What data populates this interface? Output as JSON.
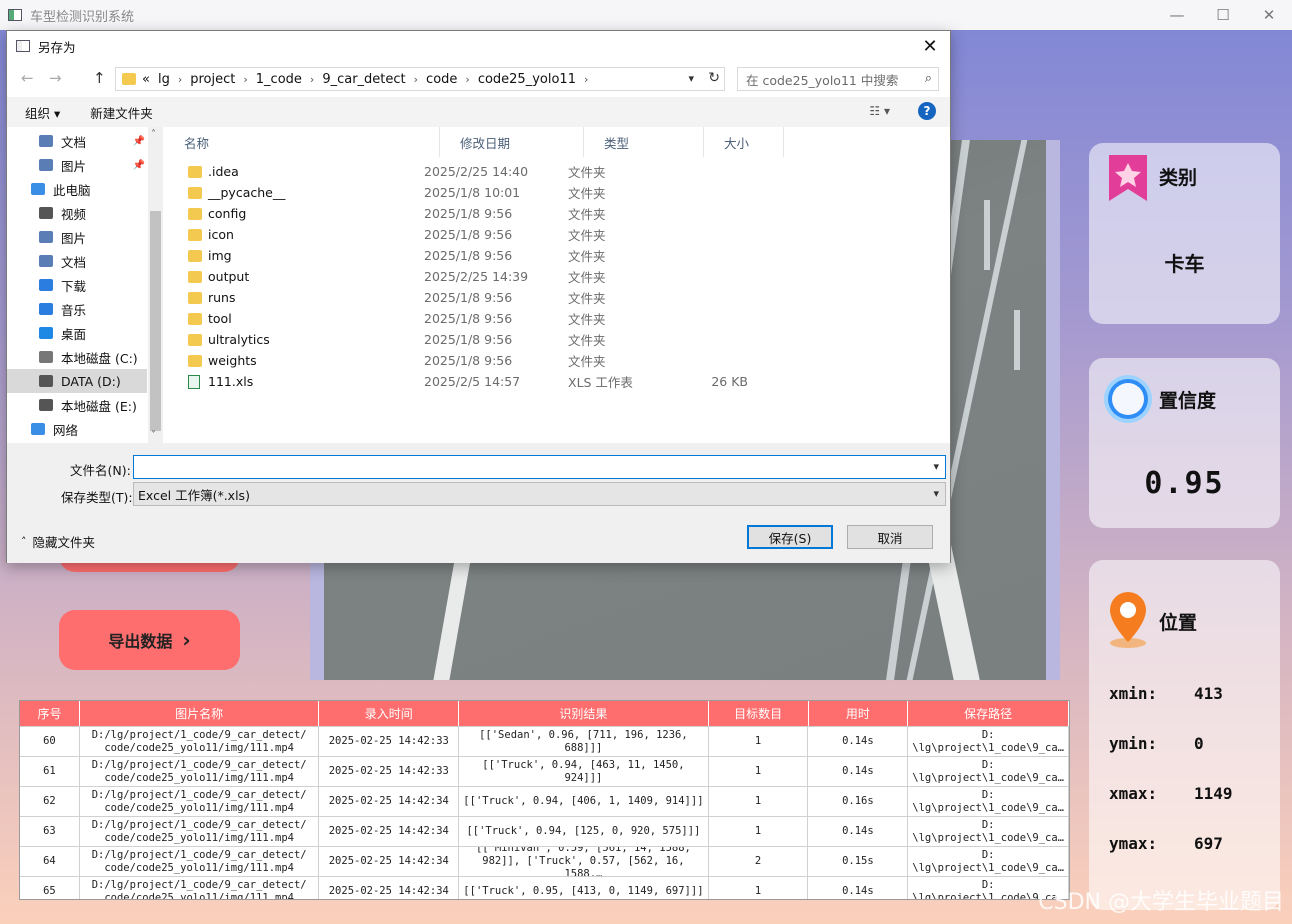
{
  "app": {
    "title": "车型检测识别系统",
    "window_controls": {
      "minimize": "—",
      "maximize": "☐",
      "close": "✕"
    }
  },
  "sidebar": {
    "export_button_label": "导出数据",
    "export_arrow": "›"
  },
  "cards": {
    "category": {
      "title": "类别",
      "value": "卡车"
    },
    "confidence": {
      "title": "置信度",
      "value": "0.95"
    },
    "location": {
      "title": "位置",
      "rows": [
        {
          "label": "xmin:",
          "value": "413"
        },
        {
          "label": "ymin:",
          "value": "0"
        },
        {
          "label": "xmax:",
          "value": "1149"
        },
        {
          "label": "ymax:",
          "value": "697"
        }
      ]
    }
  },
  "table": {
    "headers": [
      "序号",
      "图片名称",
      "录入时间",
      "识别结果",
      "目标数目",
      "用时",
      "保存路径"
    ],
    "rows": [
      [
        "60",
        "D:/lg/project/1_code/9_car_detect/\ncode/code25_yolo11/img/111.mp4",
        "2025-02-25 14:42:33",
        "[['Sedan', 0.96, [711, 196, 1236, 688]]]",
        "1",
        "0.14s",
        "D:\n\\lg\\project\\1_code\\9_ca…"
      ],
      [
        "61",
        "D:/lg/project/1_code/9_car_detect/\ncode/code25_yolo11/img/111.mp4",
        "2025-02-25 14:42:33",
        "[['Truck', 0.94, [463, 11, 1450, 924]]]",
        "1",
        "0.14s",
        "D:\n\\lg\\project\\1_code\\9_ca…"
      ],
      [
        "62",
        "D:/lg/project/1_code/9_car_detect/\ncode/code25_yolo11/img/111.mp4",
        "2025-02-25 14:42:34",
        "[['Truck', 0.94, [406, 1, 1409, 914]]]",
        "1",
        "0.16s",
        "D:\n\\lg\\project\\1_code\\9_ca…"
      ],
      [
        "63",
        "D:/lg/project/1_code/9_car_detect/\ncode/code25_yolo11/img/111.mp4",
        "2025-02-25 14:42:34",
        "[['Truck', 0.94, [125, 0, 920, 575]]]",
        "1",
        "0.14s",
        "D:\n\\lg\\project\\1_code\\9_ca…"
      ],
      [
        "64",
        "D:/lg/project/1_code/9_car_detect/\ncode/code25_yolo11/img/111.mp4",
        "2025-02-25 14:42:34",
        "[['Minivan', 0.59, [561, 14, 1588,\n982]], ['Truck', 0.57, [562, 16, 1588,…",
        "2",
        "0.15s",
        "D:\n\\lg\\project\\1_code\\9_ca…"
      ],
      [
        "65",
        "D:/lg/project/1_code/9_car_detect/\ncode/code25_yolo11/img/111.mp4",
        "2025-02-25 14:42:34",
        "[['Truck', 0.95, [413, 0, 1149, 697]]]",
        "1",
        "0.14s",
        "D:\n\\lg\\project\\1_code\\9_ca…"
      ]
    ]
  },
  "watermark": "CSDN @大学生毕业题目",
  "dialog": {
    "title": "另存为",
    "close": "✕",
    "nav": {
      "back": "←",
      "forward": "→",
      "up": "↑"
    },
    "breadcrumb": [
      "«",
      "lg",
      "project",
      "1_code",
      "9_car_detect",
      "code",
      "code25_yolo11"
    ],
    "search_placeholder": "在 code25_yolo11 中搜索",
    "toolbar": {
      "organize": "组织 ▾",
      "new_folder": "新建文件夹"
    },
    "help": "?",
    "nav_items": [
      {
        "label": "文档",
        "pinned": true
      },
      {
        "label": "图片",
        "pinned": true
      },
      {
        "label": "此电脑",
        "pinned": false
      },
      {
        "label": "视频",
        "pinned": false
      },
      {
        "label": "图片",
        "pinned": false
      },
      {
        "label": "文档",
        "pinned": false
      },
      {
        "label": "下载",
        "pinned": false
      },
      {
        "label": "音乐",
        "pinned": false
      },
      {
        "label": "桌面",
        "pinned": false
      },
      {
        "label": "本地磁盘 (C:)",
        "pinned": false
      },
      {
        "label": "DATA (D:)",
        "pinned": false,
        "selected": true
      },
      {
        "label": "本地磁盘 (E:)",
        "pinned": false
      },
      {
        "label": "网络",
        "pinned": false
      }
    ],
    "columns": [
      "名称",
      "修改日期",
      "类型",
      "大小"
    ],
    "files": [
      {
        "name": ".idea",
        "date": "2025/2/25 14:40",
        "type": "文件夹",
        "size": "",
        "kind": "folder"
      },
      {
        "name": "__pycache__",
        "date": "2025/1/8 10:01",
        "type": "文件夹",
        "size": "",
        "kind": "folder"
      },
      {
        "name": "config",
        "date": "2025/1/8 9:56",
        "type": "文件夹",
        "size": "",
        "kind": "folder"
      },
      {
        "name": "icon",
        "date": "2025/1/8 9:56",
        "type": "文件夹",
        "size": "",
        "kind": "folder"
      },
      {
        "name": "img",
        "date": "2025/1/8 9:56",
        "type": "文件夹",
        "size": "",
        "kind": "folder"
      },
      {
        "name": "output",
        "date": "2025/2/25 14:39",
        "type": "文件夹",
        "size": "",
        "kind": "folder"
      },
      {
        "name": "runs",
        "date": "2025/1/8 9:56",
        "type": "文件夹",
        "size": "",
        "kind": "folder"
      },
      {
        "name": "tool",
        "date": "2025/1/8 9:56",
        "type": "文件夹",
        "size": "",
        "kind": "folder"
      },
      {
        "name": "ultralytics",
        "date": "2025/1/8 9:56",
        "type": "文件夹",
        "size": "",
        "kind": "folder"
      },
      {
        "name": "weights",
        "date": "2025/1/8 9:56",
        "type": "文件夹",
        "size": "",
        "kind": "folder"
      },
      {
        "name": "111.xls",
        "date": "2025/2/5 14:57",
        "type": "XLS 工作表",
        "size": "26 KB",
        "kind": "xls"
      }
    ],
    "filename_label": "文件名(N):",
    "filename_value": "",
    "filetype_label": "保存类型(T):",
    "filetype_value": "Excel 工作簿(*.xls)",
    "hide_folders": "隐藏文件夹",
    "save_button": "保存(S)",
    "cancel_button": "取消"
  }
}
